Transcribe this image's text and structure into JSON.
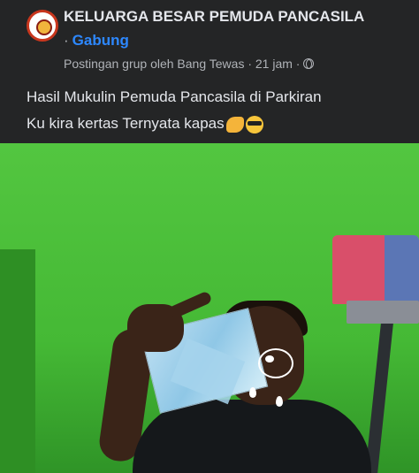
{
  "post": {
    "group_name": "KELUARGA BESAR PEMUDA PANCASILA",
    "join_separator": "·",
    "join_label": "Gabung",
    "meta_text": "Postingan grup oleh Bang Tewas · 21 jam ·",
    "privacy_icon": "globe-icon",
    "caption_line1": "Hasil Mukulin Pemuda Pancasila di Parkiran",
    "caption_line2": "Ku kira kertas Ternyata kapas",
    "caption_emojis": [
      "flexed-biceps-emoji",
      "smiling-face-with-sunglasses-emoji"
    ]
  },
  "colors": {
    "background": "#242526",
    "text_primary": "#e4e6eb",
    "text_secondary": "#b0b3b8",
    "link": "#2d88ff",
    "photo_wall": "#4ec23b"
  }
}
